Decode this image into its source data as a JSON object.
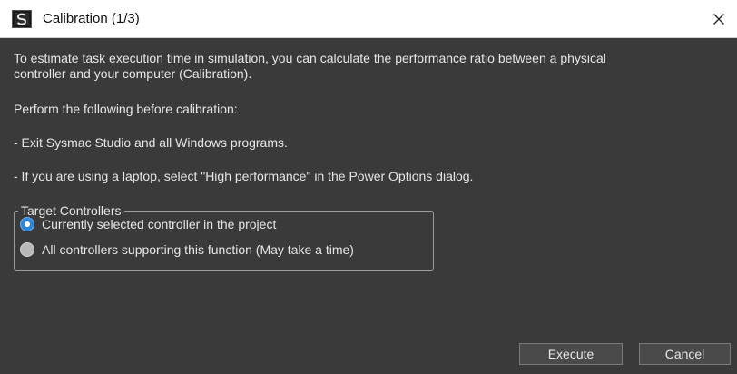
{
  "window": {
    "title": "Calibration (1/3)",
    "app_icon": "sysmac-studio-icon",
    "close_icon": "close-icon"
  },
  "content": {
    "intro_line1": "To estimate task execution time in simulation, you can calculate the performance ratio between a physical",
    "intro_line2": "controller and your computer (Calibration).",
    "perform_heading": "Perform the following before calibration:",
    "step_exit": "- Exit Sysmac Studio and all Windows programs.",
    "step_laptop": "- If you are using a laptop, select \"High performance\" in the Power Options dialog."
  },
  "target_controllers": {
    "legend": "Target Controllers",
    "options": [
      {
        "label": "Currently selected controller in the project",
        "selected": true
      },
      {
        "label": "All controllers supporting this function (May take a time)",
        "selected": false
      }
    ]
  },
  "buttons": {
    "execute": "Execute",
    "cancel": "Cancel"
  },
  "colors": {
    "dialog_background": "#3a3a3a",
    "titlebar_background": "#ffffff",
    "radio_selected": "#2f86d9",
    "text": "#e6e6e6"
  }
}
